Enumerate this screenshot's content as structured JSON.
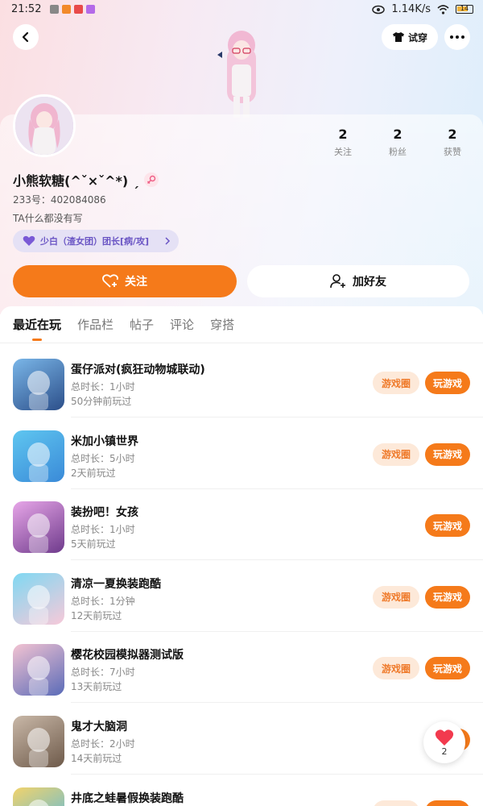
{
  "status_bar": {
    "time": "21:52",
    "network_speed": "1.14K/s",
    "battery": "14"
  },
  "header": {
    "try_on_label": "试穿"
  },
  "profile": {
    "username": "小熊软糖(^ˇ×ˇ^*) ˏ",
    "uid": "233号：402084086",
    "bio": "TA什么都没有写",
    "team_badge": "少白（渣女团）团长[病/攻]",
    "stats": [
      {
        "value": "2",
        "label": "关注"
      },
      {
        "value": "2",
        "label": "粉丝"
      },
      {
        "value": "2",
        "label": "获赞"
      }
    ]
  },
  "actions": {
    "follow_label": "关注",
    "add_friend_label": "加好友"
  },
  "tabs": [
    {
      "label": "最近在玩",
      "active": true
    },
    {
      "label": "作品栏",
      "active": false
    },
    {
      "label": "帖子",
      "active": false
    },
    {
      "label": "评论",
      "active": false
    },
    {
      "label": "穿搭",
      "active": false
    }
  ],
  "labels": {
    "circle": "游戏圈",
    "play": "玩游戏"
  },
  "games": [
    {
      "name": "蛋仔派对(疯狂动物城联动)",
      "duration": "总时长：1小时",
      "last_played": "50分钟前玩过",
      "has_circle": true,
      "icon": "eggy-party-icon",
      "colors": [
        "#7ab6e8",
        "#2c4f8a"
      ]
    },
    {
      "name": "米加小镇世界",
      "duration": "总时长：5小时",
      "last_played": "2天前玩过",
      "has_circle": true,
      "icon": "miga-town-icon",
      "colors": [
        "#5fc6f0",
        "#3a8ad8"
      ]
    },
    {
      "name": "装扮吧！女孩",
      "duration": "总时长：1小时",
      "last_played": "5天前玩过",
      "has_circle": false,
      "icon": "dress-up-girl-icon",
      "colors": [
        "#e7a6e8",
        "#6f3b8c"
      ]
    },
    {
      "name": "清凉一夏换装跑酷",
      "duration": "总时长：1分钟",
      "last_played": "12天前玩过",
      "has_circle": true,
      "icon": "summer-parkour-icon",
      "colors": [
        "#7fd8f2",
        "#f7c9d9"
      ]
    },
    {
      "name": "樱花校园模拟器测试版",
      "duration": "总时长：7小时",
      "last_played": "13天前玩过",
      "has_circle": true,
      "icon": "sakura-school-icon",
      "colors": [
        "#f3c3d2",
        "#5a6bb8"
      ]
    },
    {
      "name": "鬼才大脑洞",
      "duration": "总时长：2小时",
      "last_played": "14天前玩过",
      "has_circle": false,
      "icon": "brain-hole-icon",
      "colors": [
        "#c9b8a8",
        "#6e5a4a"
      ]
    },
    {
      "name": "井底之蛙暑假换装跑酷",
      "duration": "",
      "last_played": "",
      "has_circle": true,
      "icon": "frog-parkour-icon",
      "colors": [
        "#f2d36b",
        "#4cb7e8"
      ]
    }
  ],
  "floating_like": {
    "count": "2"
  }
}
